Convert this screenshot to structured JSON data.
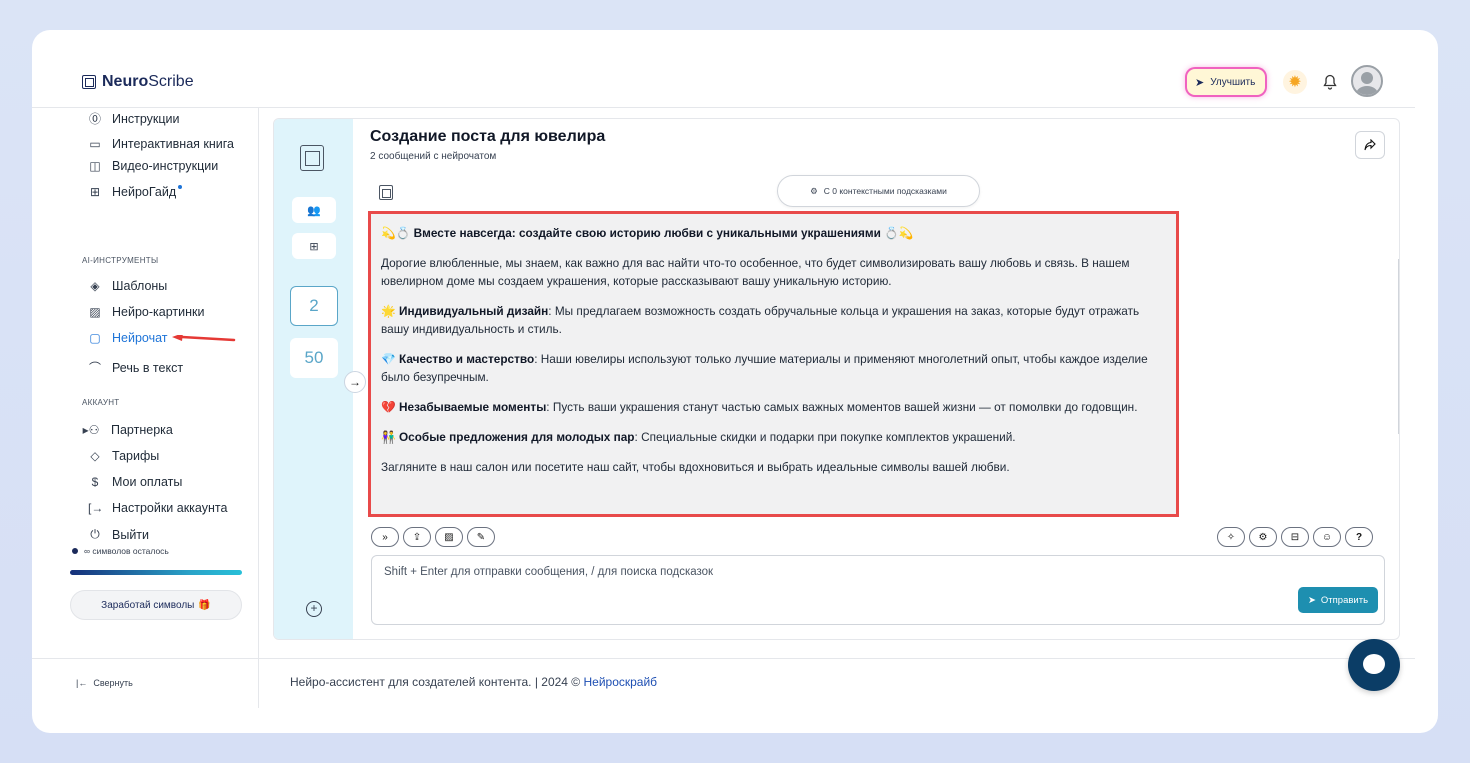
{
  "header": {
    "logo_bold": "Neuro",
    "logo_rest": "Scribe",
    "upgrade_label": "Улучшить"
  },
  "sidebar": {
    "items_top": [
      {
        "icon": "question-circle-icon",
        "label": "Инструкции"
      },
      {
        "icon": "book-icon",
        "label": "Интерактивная книга"
      },
      {
        "icon": "video-icon",
        "label": "Видео-инструкции"
      },
      {
        "icon": "grid-book-icon",
        "label": "НейроГайд"
      }
    ],
    "section_ai": "AI-ИНСТРУМЕНТЫ",
    "items_ai": [
      {
        "icon": "layers-icon",
        "label": "Шаблоны"
      },
      {
        "icon": "image-icon",
        "label": "Нейро-картинки"
      },
      {
        "icon": "chat-icon",
        "label": "Нейрочат"
      },
      {
        "icon": "headphones-icon",
        "label": "Речь в текст"
      }
    ],
    "section_account": "АККАУНТ",
    "items_account": [
      {
        "icon": "users-icon",
        "label": "Партнерка"
      },
      {
        "icon": "tag-icon",
        "label": "Тарифы"
      },
      {
        "icon": "dollar-icon",
        "label": "Мои оплаты"
      },
      {
        "icon": "login-icon",
        "label": "Настройки аккаунта"
      },
      {
        "icon": "power-icon",
        "label": "Выйти"
      }
    ],
    "symbols_left": "∞ символов осталось",
    "earn_label": "Заработай символы",
    "collapse_label": "Свернуть"
  },
  "chat": {
    "title": "Создание поста для ювелира",
    "subtitle": "2 сообщений с нейрочатом",
    "counters": [
      "2",
      "50"
    ],
    "context_label": "С 0 контекстными подсказками",
    "message": {
      "heading": "Вместе навсегда: создайте свою историю любви с уникальными украшениями",
      "intro": "Дорогие влюбленные, мы знаем, как важно для вас найти что-то особенное, что будет символизировать вашу любовь и связь. В нашем ювелирном доме мы создаем украшения, которые рассказывают вашу уникальную историю.",
      "points": [
        {
          "emoji": "🌟",
          "title": "Индивидуальный дизайн",
          "text": ": Мы предлагаем возможность создать обручальные кольца и украшения на заказ, которые будут отражать вашу индивидуальность и стиль."
        },
        {
          "emoji": "💎",
          "title": "Качество и мастерство",
          "text": ": Наши ювелиры используют только лучшие материалы и применяют многолетний опыт, чтобы каждое изделие было безупречным."
        },
        {
          "emoji": "💔",
          "title": "Незабываемые моменты",
          "text": ": Пусть ваши украшения станут частью самых важных моментов вашей жизни — от помолвки до годовщин."
        },
        {
          "emoji": "👫",
          "title": "Особые предложения для молодых пар",
          "text": ": Специальные скидки и подарки при покупке комплектов украшений."
        }
      ],
      "outro": "Загляните в наш салон или посетите наш сайт, чтобы вдохновиться и выбрать идеальные символы вашей любви."
    },
    "input_placeholder": "Shift + Enter для отправки сообщения, / для поиска подсказок",
    "send_label": "Отправить"
  },
  "footer": {
    "text": "Нейро-ассистент для создателей контента.  | 2024 © ",
    "link": "Нейроскрайб"
  },
  "colors": {
    "accent": "#1e74d8",
    "highlight_border": "#e84a4a",
    "send_button": "#1e8fb0"
  }
}
